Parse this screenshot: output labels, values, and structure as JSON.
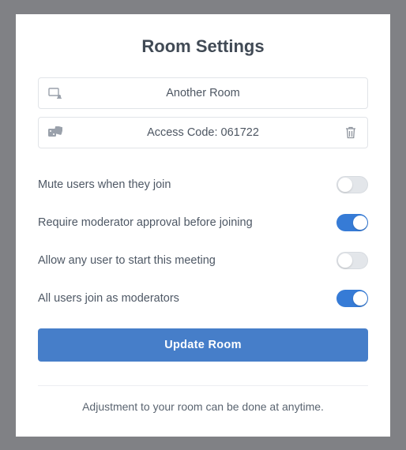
{
  "title": "Room Settings",
  "roomName": "Another Room",
  "accessCodeLabel": "Access Code: 061722",
  "settings": [
    {
      "label": "Mute users when they join",
      "enabled": false
    },
    {
      "label": "Require moderator approval before joining",
      "enabled": true
    },
    {
      "label": "Allow any user to start this meeting",
      "enabled": false
    },
    {
      "label": "All users join as moderators",
      "enabled": true
    }
  ],
  "updateButton": "Update Room",
  "footer": "Adjustment to your room can be done at anytime.",
  "colors": {
    "accent": "#467ec9",
    "toggleOn": "#367bd6",
    "text": "#4a5361"
  }
}
